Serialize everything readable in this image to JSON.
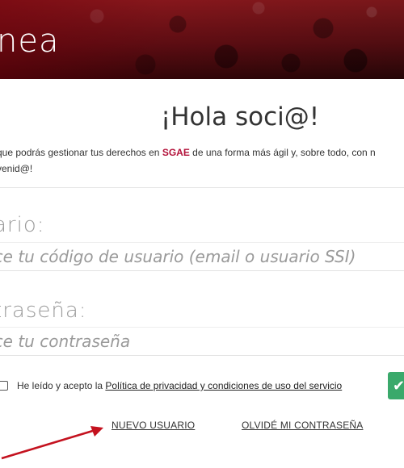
{
  "header": {
    "brand_text": "nea"
  },
  "greeting": "¡Hola soci@!",
  "intro": {
    "line1_prefix": "que podrás gestionar tus derechos en ",
    "brand": "SGAE",
    "line1_suffix": " de una forma más ágil y, sobre todo, con n",
    "line2": "venid@!"
  },
  "user_field": {
    "label": "ario:",
    "placeholder": "uce tu código de usuario (email o usuario SSI)"
  },
  "password_field": {
    "label": "traseña:",
    "placeholder": "uce tu contraseña"
  },
  "terms": {
    "prefix": "He leído y acepto la ",
    "link": "Política de privacidad y condiciones de uso del servicio"
  },
  "submit": {
    "icon": "check-icon",
    "color": "#3aa96b"
  },
  "links": {
    "new_user": "NUEVO USUARIO",
    "forgot_password": "OLVIDÉ MI CONTRASEÑA"
  },
  "colors": {
    "accent": "#b3123a",
    "header": "#8e1b1f",
    "arrow": "#c4121f"
  }
}
